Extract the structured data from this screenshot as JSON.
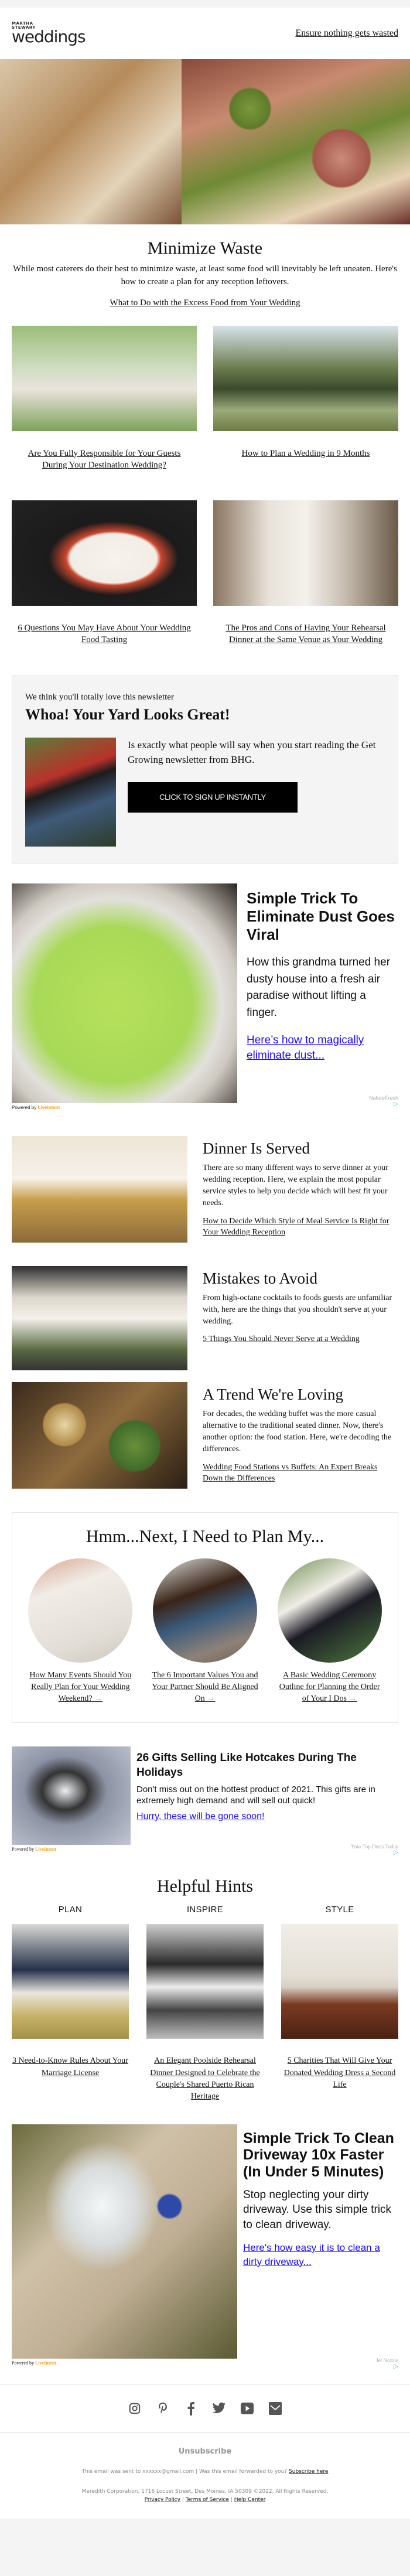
{
  "header": {
    "logo_small_1": "MARTHA",
    "logo_small_2": "STEWART",
    "logo_big": "weddings",
    "top_link": "Ensure nothing gets wasted"
  },
  "intro": {
    "title": "Minimize Waste",
    "body": "While most caterers do their best to minimize waste, at least some food will inevitably be left uneaten. Here's how to create a plan for any reception leftovers.",
    "link": "What to Do with the Excess Food from Your Wedding"
  },
  "articles": [
    {
      "title": "Are You Fully Responsible for Your Guests During Your Destination Wedding?"
    },
    {
      "title": "How to Plan a Wedding in 9 Months"
    },
    {
      "title": "6 Questions You May Have About Your Wedding Food Tasting"
    },
    {
      "title": "The Pros and Cons of Having Your Rehearsal Dinner at the Same Venue as Your Wedding"
    }
  ],
  "promo": {
    "eyebrow": "We think you'll totally love this newsletter",
    "title": "Whoa! Your Yard Looks Great!",
    "body": "Is exactly what people will say when you start reading the Get Growing newsletter from BHG.",
    "cta": "CLICK TO SIGN UP INSTANTLY"
  },
  "ads": [
    {
      "title": "Simple Trick To Eliminate Dust Goes Viral",
      "body": "How this grandma turned her dusty house into a fresh air paradise without lifting a finger.",
      "link": "Here’s how to magically eliminate dust...",
      "sponsor": "NatureFresh",
      "powered_prefix": "Powered by",
      "powered_brand": "LiveIntent"
    },
    {
      "title": "26 Gifts Selling Like Hotcakes During The Holidays",
      "body": "Don't miss out on the hottest product of 2021. This gifts are in extremely high demand and will sell out quick!",
      "link": "Hurry, these will be gone soon!",
      "sponsor": "Your Top Deals Today",
      "powered_prefix": "Powered by",
      "powered_brand": "LiveIntent"
    },
    {
      "title": "Simple Trick To Clean Driveway 10x Faster (In Under 5 Minutes)",
      "body": "Stop neglecting your dirty driveway. Use this simple trick to clean driveway.",
      "link": "Here's how easy it is to clean a dirty driveway...",
      "sponsor": "Jet Nozzle",
      "powered_prefix": "Powered by",
      "powered_brand": "LiveIntent"
    }
  ],
  "features": [
    {
      "title": "Dinner Is Served",
      "body": "There are so many different ways to serve dinner at your wedding reception. Here, we explain the most popular service styles to help you decide which will best fit your needs.",
      "link": "How to Decide Which Style of Meal Service Is Right for Your Wedding Reception"
    },
    {
      "title": "Mistakes to Avoid",
      "body": "From high-octane cocktails to foods guests are unfamiliar with, here are the things that you shouldn't serve at your wedding.",
      "link": "5 Things You Should Never Serve at a Wedding"
    },
    {
      "title": "A Trend We're Loving",
      "body": "For decades, the wedding buffet was the more casual alternative to the traditional seated dinner. Now, there's another option: the food station. Here, we're decoding the differences.",
      "link": "Wedding Food Stations vs Buffets: An Expert Breaks Down the Differences"
    }
  ],
  "plan": {
    "title": "Hmm...Next, I Need to Plan My...",
    "items": [
      {
        "title": "How Many Events Should You Really Plan for Your Wedding Weekend?"
      },
      {
        "title": "The 6 Important Values You and Your Partner Should Be Aligned On"
      },
      {
        "title": "A Basic Wedding Ceremony Outline for Planning the Order of Your I Dos"
      }
    ],
    "arrow": "→"
  },
  "hints": {
    "title": "Helpful Hints",
    "items": [
      {
        "label": "PLAN",
        "title": "3 Need-to-Know Rules About Your Marriage License"
      },
      {
        "label": "INSPIRE",
        "title": "An Elegant Poolside Rehearsal Dinner Designed to Celebrate the Couple's Shared Puerto Rican Heritage"
      },
      {
        "label": "STYLE",
        "title": "5 Charities That Will Give Your Donated Wedding Dress a Second Life"
      }
    ]
  },
  "footer": {
    "unsubscribe": "Unsubscribe",
    "sent_text": "This email was sent to xxxxxx@gmail.com  |  Was this email forwarded to you?",
    "subscribe_link": "Subscribe here",
    "address": "Meredith Corporation, 1716 Locust Street, Des Moines, IA 50309 ©2022. All Rights Reserved.",
    "privacy": "Privacy Policy",
    "terms": "Terms of Service",
    "help": "Help Center",
    "sep": "|"
  },
  "social": [
    "instagram",
    "pinterest",
    "facebook",
    "twitter",
    "youtube",
    "email"
  ]
}
